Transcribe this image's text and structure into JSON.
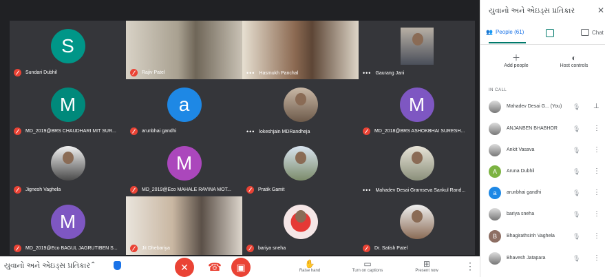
{
  "meeting_title": "યુવાનો અને એઇડ્સ પ્રતિકાર",
  "tiles": [
    {
      "name": "Sundari Dubhil",
      "initial": "S",
      "color": "#009688",
      "kind": "initial",
      "muted": true
    },
    {
      "name": "Rajiv Patel",
      "kind": "video",
      "muted": true
    },
    {
      "name": "Hasmukh Panchal",
      "kind": "video",
      "muted": false
    },
    {
      "name": "Gaurang Jani",
      "kind": "photo",
      "muted": false
    },
    {
      "name": "MD_2019@BRS CHAUDHARI MIT SUR...",
      "initial": "M",
      "color": "#00897b",
      "kind": "initial",
      "muted": true
    },
    {
      "name": "arunbhai gandhi",
      "initial": "a",
      "color": "#1e88e5",
      "kind": "initial",
      "muted": true
    },
    {
      "name": "lokeshjain MDRandheja",
      "kind": "photo",
      "muted": false
    },
    {
      "name": "MD_2018@BRS ASHOKBHAI SURESH...",
      "initial": "M",
      "color": "#7e57c2",
      "kind": "initial",
      "muted": true
    },
    {
      "name": "Jignesh Vaghela",
      "kind": "photo",
      "muted": true
    },
    {
      "name": "MD_2019@Eco MAHALE RAVINA MOT...",
      "initial": "M",
      "color": "#ab47bc",
      "kind": "initial",
      "muted": true
    },
    {
      "name": "Pratik Gamit",
      "kind": "photo",
      "muted": true
    },
    {
      "name": "Mahadev Desai Gramseva Sankul Rand...",
      "kind": "photo",
      "muted": false
    },
    {
      "name": "MD_2019@Eco BAGUL JAGRUTIBEN S...",
      "initial": "M",
      "color": "#7e57c2",
      "kind": "initial",
      "muted": true
    },
    {
      "name": "Jit Dhebariya",
      "kind": "video",
      "muted": true
    },
    {
      "name": "bariya sneha",
      "kind": "photo",
      "muted": true
    },
    {
      "name": "Dr. Satish Patel",
      "kind": "photo",
      "muted": true
    }
  ],
  "toolbar": {
    "raise_hand": "Raise hand",
    "captions": "Turn on captions",
    "present": "Present now"
  },
  "panel": {
    "title": "યુવાનો અને એઇડ્સ પ્રતિકાર",
    "people_tab": "People (61)",
    "chat_tab": "Chat",
    "add_people": "Add people",
    "host_controls": "Host controls",
    "in_call": "IN CALL",
    "people": [
      {
        "name": "Mahadev Desai G... (You)",
        "initial": "",
        "color": ""
      },
      {
        "name": "ANJANBEN BHABHOR",
        "initial": "",
        "color": ""
      },
      {
        "name": "Ankit Vasava",
        "initial": "",
        "color": ""
      },
      {
        "name": "Aruna Dubhil",
        "initial": "A",
        "color": "#7cb342"
      },
      {
        "name": "arunbhai gandhi",
        "initial": "a",
        "color": "#1e88e5"
      },
      {
        "name": "bariya sneha",
        "initial": "",
        "color": ""
      },
      {
        "name": "Bhagirathsinh Vaghela",
        "initial": "B",
        "color": "#8d6e63"
      },
      {
        "name": "Bhavesh Jatapara",
        "initial": "",
        "color": ""
      }
    ]
  }
}
